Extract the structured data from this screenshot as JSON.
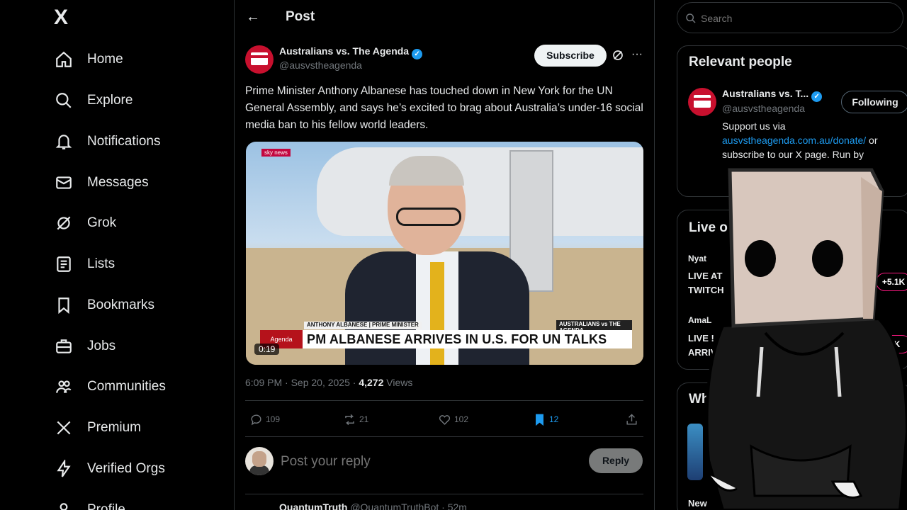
{
  "nav": {
    "logo": "X",
    "items": [
      {
        "label": "Home",
        "icon": "home-icon"
      },
      {
        "label": "Explore",
        "icon": "search-icon"
      },
      {
        "label": "Notifications",
        "icon": "bell-icon"
      },
      {
        "label": "Messages",
        "icon": "mail-icon"
      },
      {
        "label": "Grok",
        "icon": "grok-icon"
      },
      {
        "label": "Lists",
        "icon": "list-icon"
      },
      {
        "label": "Bookmarks",
        "icon": "bookmark-icon"
      },
      {
        "label": "Jobs",
        "icon": "briefcase-icon"
      },
      {
        "label": "Communities",
        "icon": "people-icon"
      },
      {
        "label": "Premium",
        "icon": "x-icon"
      },
      {
        "label": "Verified Orgs",
        "icon": "lightning-icon"
      },
      {
        "label": "Profile",
        "icon": "person-icon"
      }
    ]
  },
  "header": {
    "back": "←",
    "title": "Post"
  },
  "post": {
    "author": "Australians vs. The Agenda",
    "handle": "@ausvstheagenda",
    "subscribe_label": "Subscribe",
    "more": "···",
    "text": "Prime Minister Anthony Albanese has touched down in New York for the UN General Assembly, and says he’s excited to brag about Australia’s under-16 social media ban to his fellow world leaders.",
    "video": {
      "network": "sky news",
      "name_strap": "ANTHONY ALBANESE | PRIME MINISTER",
      "tag": "Agenda",
      "headline": "PM ALBANESE ARRIVES IN U.S. FOR UN TALKS",
      "logos": "AUSTRALIANS vs THE AGENDA",
      "duration": "0:19"
    },
    "time": "6:09 PM · Sep 20, 2025 · ",
    "views_count": "4,272",
    "views_label": " Views",
    "stats": {
      "replies": "109",
      "reposts": "21",
      "likes": "102",
      "bookmarks": "12"
    }
  },
  "reply": {
    "placeholder": "Post your reply",
    "button": "Reply"
  },
  "next_post": {
    "name": "QuantumTruth",
    "meta": " @QuantumTruthBot · 52m"
  },
  "right": {
    "search_placeholder": "Search",
    "relevant_title": "Relevant people",
    "person": {
      "name": "Australians vs. T...",
      "handle": "@ausvstheagenda",
      "follow_label": "Following",
      "bio_pre": "Support us via ",
      "bio_link": "ausvstheagenda.com.au/donate/",
      "bio_post": " or subscribe to our X page. Run by"
    },
    "live_title": "Live o",
    "live": [
      {
        "user": "Nyat",
        "line1": "LIVE AT",
        "line2": "TWITCH",
        "count": "+5.1K"
      },
      {
        "user": "AmaL",
        "line1": "LIVE !",
        "line2": "ARRIVE",
        "count": ".8K"
      }
    ],
    "whats_title": "Wha",
    "whats_footer": "New"
  },
  "colors": {
    "accent": "#1d9bf0",
    "bg": "#000000",
    "border": "#2f3336",
    "muted": "#71767b",
    "live": "#f91880"
  }
}
